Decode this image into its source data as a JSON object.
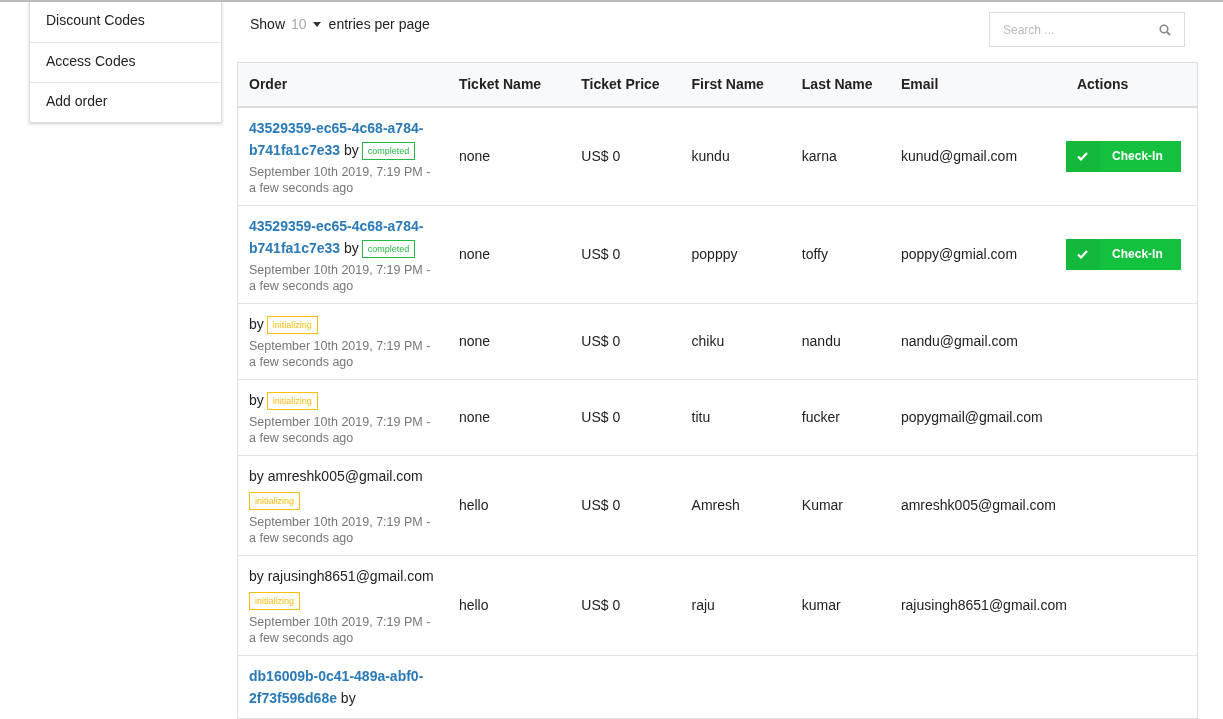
{
  "sidebar": {
    "items": [
      {
        "label": "Discount Codes"
      },
      {
        "label": "Access Codes"
      },
      {
        "label": "Add order"
      }
    ]
  },
  "entries": {
    "show_label": "Show",
    "value": "10",
    "suffix": "entries per page"
  },
  "search": {
    "placeholder": "Search ..."
  },
  "table": {
    "columns": [
      "Order",
      "Ticket Name",
      "Ticket Price",
      "First Name",
      "Last Name",
      "Email",
      "Actions"
    ],
    "rows": [
      {
        "order_id": [
          "43529359-ec65-4c68-a784-",
          "b741fa1c7e33"
        ],
        "by": "by",
        "status": "completed",
        "date": "September 10th 2019, 7:19 PM - a few seconds ago",
        "ticket_name": "none",
        "ticket_price": "US$ 0",
        "first_name": "kundu",
        "last_name": "karna",
        "email": "kunud@gmail.com",
        "action": "Check-In"
      },
      {
        "order_id": [
          "43529359-ec65-4c68-a784-",
          "b741fa1c7e33"
        ],
        "by": "by",
        "status": "completed",
        "date": "September 10th 2019, 7:19 PM - a few seconds ago",
        "ticket_name": "none",
        "ticket_price": "US$ 0",
        "first_name": "popppy",
        "last_name": "toffy",
        "email": "poppy@gmial.com",
        "action": "Check-In"
      },
      {
        "by": "by",
        "status": "initializing",
        "date": "September 10th 2019, 7:19 PM - a few seconds ago",
        "ticket_name": "none",
        "ticket_price": "US$ 0",
        "first_name": "chiku",
        "last_name": "nandu",
        "email": "nandu@gmail.com"
      },
      {
        "by": "by",
        "status": "initializing",
        "date": "September 10th 2019, 7:19 PM - a few seconds ago",
        "ticket_name": "none",
        "ticket_price": "US$ 0",
        "first_name": "titu",
        "last_name": "fucker",
        "email": "popygmail@gmail.com"
      },
      {
        "by": "by amreshk005@gmail.com",
        "status": "initializing",
        "date": "September 10th 2019, 7:19 PM - a few seconds ago",
        "ticket_name": "hello",
        "ticket_price": "US$ 0",
        "first_name": "Amresh",
        "last_name": "Kumar",
        "email": "amreshk005@gmail.com"
      },
      {
        "by": "by rajusingh8651@gmail.com",
        "status": "initializing",
        "date": "September 10th 2019, 7:19 PM - a few seconds ago",
        "ticket_name": "hello",
        "ticket_price": "US$ 0",
        "first_name": "raju",
        "last_name": "kumar",
        "email": "rajusingh8651@gmail.com"
      },
      {
        "order_id": [
          "db16009b-0c41-489a-abf0-",
          "2f73f596d68e"
        ],
        "by": "by"
      }
    ]
  }
}
